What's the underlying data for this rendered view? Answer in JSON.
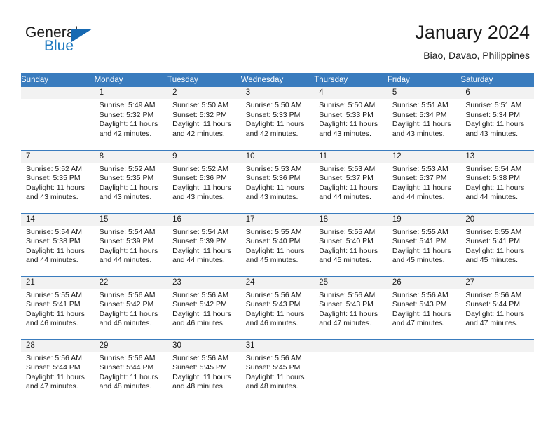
{
  "logo": {
    "word1": "General",
    "word2": "Blue",
    "triangle_color": "#1669b2",
    "blue_color": "#1f7ac0"
  },
  "header": {
    "title": "January 2024",
    "subtitle": "Biao, Davao, Philippines"
  },
  "theme": {
    "header_blue": "#3a7cbe",
    "band_gray": "#f2f2f2",
    "text": "#1a1a1a"
  },
  "weekdays": [
    "Sunday",
    "Monday",
    "Tuesday",
    "Wednesday",
    "Thursday",
    "Friday",
    "Saturday"
  ],
  "weeks": [
    [
      {
        "day": "",
        "empty": true
      },
      {
        "day": "1",
        "sunrise": "Sunrise: 5:49 AM",
        "sunset": "Sunset: 5:32 PM",
        "daylight1": "Daylight: 11 hours",
        "daylight2": "and 42 minutes."
      },
      {
        "day": "2",
        "sunrise": "Sunrise: 5:50 AM",
        "sunset": "Sunset: 5:32 PM",
        "daylight1": "Daylight: 11 hours",
        "daylight2": "and 42 minutes."
      },
      {
        "day": "3",
        "sunrise": "Sunrise: 5:50 AM",
        "sunset": "Sunset: 5:33 PM",
        "daylight1": "Daylight: 11 hours",
        "daylight2": "and 42 minutes."
      },
      {
        "day": "4",
        "sunrise": "Sunrise: 5:50 AM",
        "sunset": "Sunset: 5:33 PM",
        "daylight1": "Daylight: 11 hours",
        "daylight2": "and 43 minutes."
      },
      {
        "day": "5",
        "sunrise": "Sunrise: 5:51 AM",
        "sunset": "Sunset: 5:34 PM",
        "daylight1": "Daylight: 11 hours",
        "daylight2": "and 43 minutes."
      },
      {
        "day": "6",
        "sunrise": "Sunrise: 5:51 AM",
        "sunset": "Sunset: 5:34 PM",
        "daylight1": "Daylight: 11 hours",
        "daylight2": "and 43 minutes."
      }
    ],
    [
      {
        "day": "7",
        "sunrise": "Sunrise: 5:52 AM",
        "sunset": "Sunset: 5:35 PM",
        "daylight1": "Daylight: 11 hours",
        "daylight2": "and 43 minutes."
      },
      {
        "day": "8",
        "sunrise": "Sunrise: 5:52 AM",
        "sunset": "Sunset: 5:35 PM",
        "daylight1": "Daylight: 11 hours",
        "daylight2": "and 43 minutes."
      },
      {
        "day": "9",
        "sunrise": "Sunrise: 5:52 AM",
        "sunset": "Sunset: 5:36 PM",
        "daylight1": "Daylight: 11 hours",
        "daylight2": "and 43 minutes."
      },
      {
        "day": "10",
        "sunrise": "Sunrise: 5:53 AM",
        "sunset": "Sunset: 5:36 PM",
        "daylight1": "Daylight: 11 hours",
        "daylight2": "and 43 minutes."
      },
      {
        "day": "11",
        "sunrise": "Sunrise: 5:53 AM",
        "sunset": "Sunset: 5:37 PM",
        "daylight1": "Daylight: 11 hours",
        "daylight2": "and 44 minutes."
      },
      {
        "day": "12",
        "sunrise": "Sunrise: 5:53 AM",
        "sunset": "Sunset: 5:37 PM",
        "daylight1": "Daylight: 11 hours",
        "daylight2": "and 44 minutes."
      },
      {
        "day": "13",
        "sunrise": "Sunrise: 5:54 AM",
        "sunset": "Sunset: 5:38 PM",
        "daylight1": "Daylight: 11 hours",
        "daylight2": "and 44 minutes."
      }
    ],
    [
      {
        "day": "14",
        "sunrise": "Sunrise: 5:54 AM",
        "sunset": "Sunset: 5:38 PM",
        "daylight1": "Daylight: 11 hours",
        "daylight2": "and 44 minutes."
      },
      {
        "day": "15",
        "sunrise": "Sunrise: 5:54 AM",
        "sunset": "Sunset: 5:39 PM",
        "daylight1": "Daylight: 11 hours",
        "daylight2": "and 44 minutes."
      },
      {
        "day": "16",
        "sunrise": "Sunrise: 5:54 AM",
        "sunset": "Sunset: 5:39 PM",
        "daylight1": "Daylight: 11 hours",
        "daylight2": "and 44 minutes."
      },
      {
        "day": "17",
        "sunrise": "Sunrise: 5:55 AM",
        "sunset": "Sunset: 5:40 PM",
        "daylight1": "Daylight: 11 hours",
        "daylight2": "and 45 minutes."
      },
      {
        "day": "18",
        "sunrise": "Sunrise: 5:55 AM",
        "sunset": "Sunset: 5:40 PM",
        "daylight1": "Daylight: 11 hours",
        "daylight2": "and 45 minutes."
      },
      {
        "day": "19",
        "sunrise": "Sunrise: 5:55 AM",
        "sunset": "Sunset: 5:41 PM",
        "daylight1": "Daylight: 11 hours",
        "daylight2": "and 45 minutes."
      },
      {
        "day": "20",
        "sunrise": "Sunrise: 5:55 AM",
        "sunset": "Sunset: 5:41 PM",
        "daylight1": "Daylight: 11 hours",
        "daylight2": "and 45 minutes."
      }
    ],
    [
      {
        "day": "21",
        "sunrise": "Sunrise: 5:55 AM",
        "sunset": "Sunset: 5:41 PM",
        "daylight1": "Daylight: 11 hours",
        "daylight2": "and 46 minutes."
      },
      {
        "day": "22",
        "sunrise": "Sunrise: 5:56 AM",
        "sunset": "Sunset: 5:42 PM",
        "daylight1": "Daylight: 11 hours",
        "daylight2": "and 46 minutes."
      },
      {
        "day": "23",
        "sunrise": "Sunrise: 5:56 AM",
        "sunset": "Sunset: 5:42 PM",
        "daylight1": "Daylight: 11 hours",
        "daylight2": "and 46 minutes."
      },
      {
        "day": "24",
        "sunrise": "Sunrise: 5:56 AM",
        "sunset": "Sunset: 5:43 PM",
        "daylight1": "Daylight: 11 hours",
        "daylight2": "and 46 minutes."
      },
      {
        "day": "25",
        "sunrise": "Sunrise: 5:56 AM",
        "sunset": "Sunset: 5:43 PM",
        "daylight1": "Daylight: 11 hours",
        "daylight2": "and 47 minutes."
      },
      {
        "day": "26",
        "sunrise": "Sunrise: 5:56 AM",
        "sunset": "Sunset: 5:43 PM",
        "daylight1": "Daylight: 11 hours",
        "daylight2": "and 47 minutes."
      },
      {
        "day": "27",
        "sunrise": "Sunrise: 5:56 AM",
        "sunset": "Sunset: 5:44 PM",
        "daylight1": "Daylight: 11 hours",
        "daylight2": "and 47 minutes."
      }
    ],
    [
      {
        "day": "28",
        "sunrise": "Sunrise: 5:56 AM",
        "sunset": "Sunset: 5:44 PM",
        "daylight1": "Daylight: 11 hours",
        "daylight2": "and 47 minutes."
      },
      {
        "day": "29",
        "sunrise": "Sunrise: 5:56 AM",
        "sunset": "Sunset: 5:44 PM",
        "daylight1": "Daylight: 11 hours",
        "daylight2": "and 48 minutes."
      },
      {
        "day": "30",
        "sunrise": "Sunrise: 5:56 AM",
        "sunset": "Sunset: 5:45 PM",
        "daylight1": "Daylight: 11 hours",
        "daylight2": "and 48 minutes."
      },
      {
        "day": "31",
        "sunrise": "Sunrise: 5:56 AM",
        "sunset": "Sunset: 5:45 PM",
        "daylight1": "Daylight: 11 hours",
        "daylight2": "and 48 minutes."
      },
      {
        "day": "",
        "empty": true
      },
      {
        "day": "",
        "empty": true
      },
      {
        "day": "",
        "empty": true
      }
    ]
  ]
}
